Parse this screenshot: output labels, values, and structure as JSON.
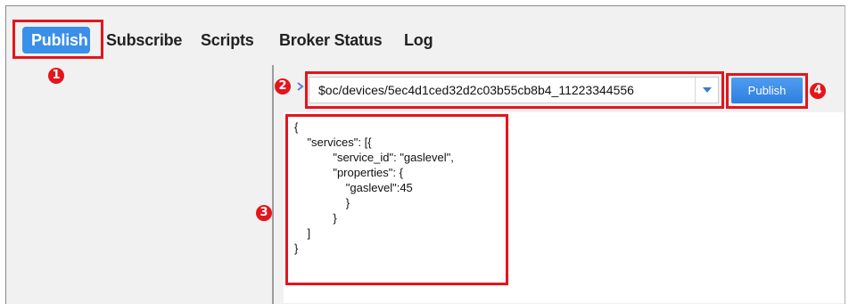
{
  "tabs": [
    {
      "label": "Publish",
      "active": true
    },
    {
      "label": "Subscribe",
      "active": false
    },
    {
      "label": "Scripts",
      "active": false
    },
    {
      "label": "Broker Status",
      "active": false
    },
    {
      "label": "Log",
      "active": false
    }
  ],
  "annotations": {
    "step1": "1",
    "step2": "2",
    "step3": "3",
    "step4": "4"
  },
  "topic": {
    "value": "$oc/devices/5ec4d1ced32d2c03b55cb8b4_11223344556"
  },
  "publish_button": {
    "label": "Publish"
  },
  "payload": {
    "lines": [
      "{",
      "    \"services\": [{",
      "            \"service_id\": \"gaslevel\",",
      "            \"properties\": {",
      "                \"gaslevel\":45",
      "                }",
      "            }",
      "    ]",
      "}"
    ]
  },
  "colors": {
    "accent": "#3a8fe8",
    "annotation_red": "#e4151b",
    "panel_bg": "#f1f1f1"
  },
  "icons": {
    "topic_arrow": "chevron-right-icon",
    "dropdown": "chevron-down-icon"
  }
}
